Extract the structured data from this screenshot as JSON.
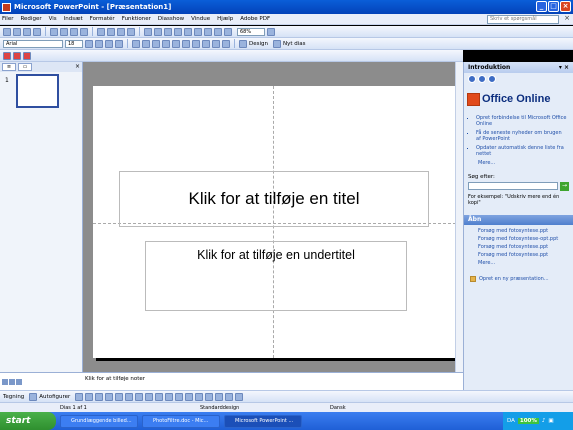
{
  "window": {
    "title": "Microsoft PowerPoint - [Præsentation1]"
  },
  "menu": {
    "items": [
      "Filer",
      "Rediger",
      "Vis",
      "Indsæt",
      "Formatér",
      "Funktioner",
      "Diasshow",
      "Vindue",
      "Hjælp",
      "Adobe PDF"
    ],
    "help_placeholder": "Skriv et spørgsmål"
  },
  "toolbar": {
    "zoom": "68%",
    "font": "Arial",
    "size": "18",
    "design_label": "Design",
    "new_slide_label": "Nyt dias"
  },
  "slide": {
    "title_placeholder": "Klik for at tilføje en titel",
    "subtitle_placeholder": "Klik for at tilføje en undertitel",
    "number": "1"
  },
  "notes": {
    "placeholder": "Klik for at tilføje noter"
  },
  "taskpane": {
    "title": "Introduktion",
    "brand": "Office Online",
    "links": [
      "Opret forbindelse til Microsoft Office Online",
      "Få de seneste nyheder om brugen af PowerPoint",
      "Opdater automatisk denne liste fra nettet"
    ],
    "more": "Mere...",
    "search_label": "Søg efter:",
    "example": "For eksempel: \"Udskriv mere end én kopi\"",
    "open_section": "Åbn",
    "files": [
      "Forsøg med fotosyntese.ppt",
      "Forsøg med fotosyntese-opt.ppt",
      "Forsøg med fotosyntese.ppt",
      "Forsøg med fotosyntese.ppt"
    ],
    "files_more": "Mere...",
    "new_presentation": "Opret en ny præsentation..."
  },
  "drawing": {
    "draw_label": "Tegning",
    "autoshapes_label": "Autofigurer"
  },
  "status": {
    "slide": "Dias 1 af 1",
    "design": "Standarddesign",
    "language": "Dansk"
  },
  "taskbar": {
    "start": "start",
    "tasks": [
      "Grundlæggende billed...",
      "PhotoFiltre.doc - Mic...",
      "Microsoft PowerPoint ..."
    ],
    "tray_lang": "DA",
    "tray_zoom": "100%"
  }
}
